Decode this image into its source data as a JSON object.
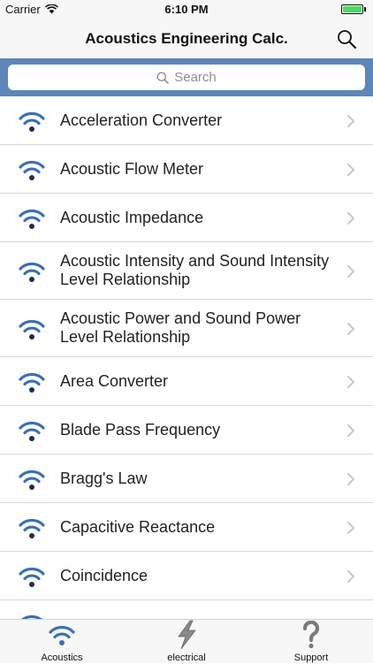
{
  "status_bar": {
    "carrier": "Carrier",
    "time": "6:10 PM"
  },
  "nav": {
    "title": "Acoustics Engineering Calc."
  },
  "search": {
    "placeholder": "Search"
  },
  "list": {
    "items": [
      {
        "label": "Acceleration Converter"
      },
      {
        "label": "Acoustic Flow Meter"
      },
      {
        "label": "Acoustic Impedance"
      },
      {
        "label": "Acoustic Intensity and Sound Intensity Level Relationship"
      },
      {
        "label": "Acoustic Power and Sound Power Level Relationship"
      },
      {
        "label": "Area Converter"
      },
      {
        "label": "Blade Pass Frequency"
      },
      {
        "label": "Bragg's Law"
      },
      {
        "label": "Capacitive Reactance"
      },
      {
        "label": "Coincidence"
      }
    ]
  },
  "tabs": [
    {
      "label": "Acoustics",
      "icon": "wifi-icon"
    },
    {
      "label": "electrical",
      "icon": "lightning-icon"
    },
    {
      "label": "Support",
      "icon": "question-icon"
    }
  ],
  "colors": {
    "accent": "#5d86b9",
    "icon_blue": "#3b6fb5"
  }
}
